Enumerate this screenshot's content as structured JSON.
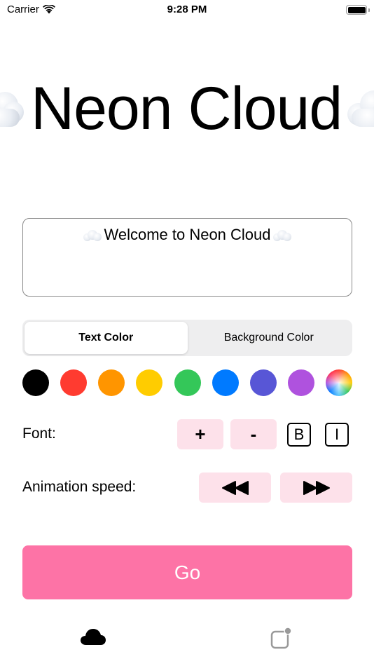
{
  "status_bar": {
    "carrier": "Carrier",
    "time": "9:28 PM",
    "wifi_icon": "wifi-icon",
    "battery_icon": "battery-full-icon"
  },
  "marquee": {
    "text": "Neon Cloud",
    "leading_icon": "cloud-emoji",
    "trailing_icon": "cloud-emoji"
  },
  "message_input": {
    "value": "Welcome to Neon Cloud",
    "leading_icon": "cloud-emoji",
    "trailing_icon": "cloud-emoji"
  },
  "color_target": {
    "segments": [
      {
        "label": "Text Color",
        "selected": true
      },
      {
        "label": "Background Color",
        "selected": false
      }
    ]
  },
  "color_swatches": [
    {
      "name": "black",
      "color": "#000000"
    },
    {
      "name": "red",
      "color": "#ff3b30"
    },
    {
      "name": "orange",
      "color": "#ff9500"
    },
    {
      "name": "yellow",
      "color": "#ffcc00"
    },
    {
      "name": "green",
      "color": "#34c759"
    },
    {
      "name": "blue",
      "color": "#007aff"
    },
    {
      "name": "indigo",
      "color": "#5856d6"
    },
    {
      "name": "purple",
      "color": "#af52de"
    },
    {
      "name": "custom-color-wheel",
      "color": "multicolor"
    }
  ],
  "font_controls": {
    "label": "Font:",
    "increase_label": "+",
    "decrease_label": "-",
    "bold_label": "B",
    "italic_label": "I"
  },
  "animation_controls": {
    "label": "Animation speed:",
    "slower_icon": "rewind-icon",
    "faster_icon": "fast-forward-icon"
  },
  "go_button": {
    "label": "Go"
  },
  "tab_bar": {
    "tabs": [
      {
        "icon": "cloud-fill-icon",
        "selected": true
      },
      {
        "icon": "app-badge-icon",
        "selected": false
      }
    ]
  },
  "colors": {
    "accent_pink": "#fd73a6",
    "button_pink_bg": "#fde1ea",
    "segment_bg": "#eeeeef"
  }
}
